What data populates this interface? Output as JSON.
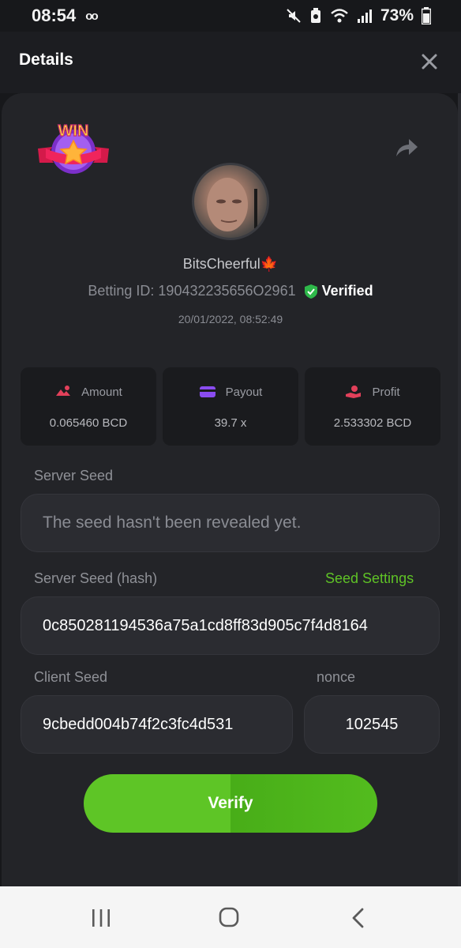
{
  "status_bar": {
    "time": "08:54",
    "battery": "73%",
    "icons": [
      "voicemail-icon",
      "mute-icon",
      "data-saver-icon",
      "wifi-icon",
      "signal-icon",
      "battery-icon"
    ]
  },
  "header": {
    "title": "Details",
    "close_icon": "close-icon"
  },
  "bet": {
    "badge_text": "WIN",
    "username": "BitsCheerful🍁",
    "betting_id": "Betting ID: 190432235656O2961",
    "verified_label": "Verified",
    "datetime": "20/01/2022, 08:52:49"
  },
  "stats": [
    {
      "label": "Amount",
      "value": "0.065460 BCD",
      "icon": "amount-icon",
      "color": "#e2405a"
    },
    {
      "label": "Payout",
      "value": "39.7 x",
      "icon": "card-icon",
      "color": "#8a4cf0"
    },
    {
      "label": "Profit",
      "value": "2.533302 BCD",
      "icon": "profit-hand-icon",
      "color": "#e2405a"
    }
  ],
  "server_seed": {
    "label": "Server Seed",
    "value": "The seed hasn't been revealed yet."
  },
  "server_seed_hash": {
    "label": "Server Seed (hash)",
    "link": "Seed Settings",
    "value": "0c850281194536a75a1cd8ff83d905c7f4d8164"
  },
  "client_seed": {
    "label": "Client Seed",
    "value": "9cbedd004b74f2c3fc4d531"
  },
  "nonce": {
    "label": "nonce",
    "value": "102545"
  },
  "verify_button": "Verify",
  "colors": {
    "accent_green": "#5fc326",
    "background": "#17181b",
    "card": "#232428",
    "verified_shield": "#2eb84a"
  }
}
